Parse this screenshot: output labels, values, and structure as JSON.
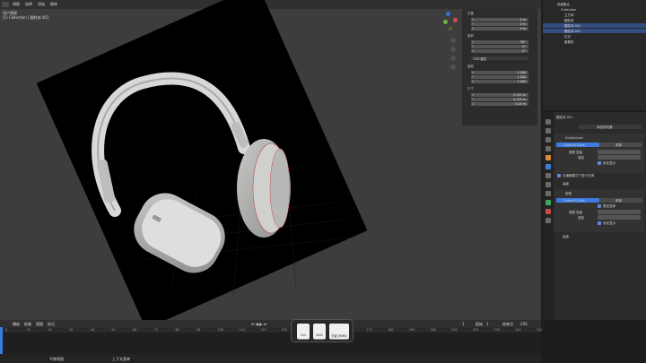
{
  "viewport": {
    "info_lines": [
      "用户透视",
      "(1) Collection | 圆柱体.001"
    ],
    "header_items": [
      "视图",
      "选择",
      "添加",
      "物体"
    ]
  },
  "n_panel": {
    "location_title": "位置",
    "rotation_title": "旋转",
    "rotation_mode": "XYZ 欧拉",
    "scale_title": "缩放",
    "dimensions_title": "尺寸",
    "location": [
      {
        "axis": "X",
        "value": "0 m"
      },
      {
        "axis": "Y",
        "value": "0 m"
      },
      {
        "axis": "Z",
        "value": "0 m"
      }
    ],
    "rotation": [
      {
        "axis": "X",
        "value": "90°"
      },
      {
        "axis": "Y",
        "value": "0°"
      },
      {
        "axis": "Z",
        "value": "0°"
      }
    ],
    "scale": [
      {
        "axis": "X",
        "value": "1.000"
      },
      {
        "axis": "Y",
        "value": "1.000"
      },
      {
        "axis": "Z",
        "value": "1.000"
      }
    ],
    "dimensions": [
      {
        "axis": "X",
        "value": "0.193 m"
      },
      {
        "axis": "Y",
        "value": "0.193 m"
      },
      {
        "axis": "Z",
        "value": "0.04 m"
      }
    ]
  },
  "outliner": {
    "rows": [
      {
        "label": "场景集合",
        "indent": 0,
        "selected": false
      },
      {
        "label": "Collection",
        "indent": 4,
        "selected": false
      },
      {
        "label": "立方体",
        "indent": 8,
        "selected": false
      },
      {
        "label": "圆柱体",
        "indent": 8,
        "selected": false
      },
      {
        "label": "圆柱体.001",
        "indent": 8,
        "selected": true
      },
      {
        "label": "圆柱体.002",
        "indent": 8,
        "selected": true
      },
      {
        "label": "灯光",
        "indent": 8,
        "selected": false
      },
      {
        "label": "摄像机",
        "indent": 8,
        "selected": false
      }
    ]
  },
  "properties": {
    "context": "圆柱体.001",
    "modifier_add": "添加修改器",
    "modifier1": {
      "name": "Subdivision",
      "tab_a": "Catmull-Clark",
      "tab_b": "简单",
      "field1": "视图 层级",
      "field2": "渲染",
      "check": "优化显示"
    },
    "extra": "在编辑模式下进行光滑",
    "sub_label": "高级",
    "modifier2": {
      "name": "倒角",
      "tab_a": "Catmull-Clark",
      "tab_b": "简单",
      "check0": "限定选择",
      "field1": "视图 层级",
      "field2": "渲染",
      "check": "优化显示"
    },
    "footer": "高级"
  },
  "timeline": {
    "menus": [
      "播放",
      "抠像",
      "视图",
      "标记"
    ],
    "frame_current": "1",
    "start_label": "起始",
    "start_value": "1",
    "end_label": "结束点",
    "end_value": "250",
    "ticks": [
      "0",
      "10",
      "20",
      "30",
      "40",
      "50",
      "60",
      "70",
      "80",
      "90",
      "100",
      "110",
      "120",
      "130",
      "140",
      "150",
      "160",
      "170",
      "180",
      "190",
      "200",
      "210",
      "220",
      "230",
      "240",
      "250"
    ],
    "status_left": "平移视图",
    "status_mid": "上下文菜单"
  },
  "keys": [
    {
      "label": "Ctrl"
    },
    {
      "label": "Shift"
    },
    {
      "label": "右键 (RMB)"
    }
  ],
  "colors": {
    "accent": "#3d7be0",
    "selected_row": "#334d80",
    "header": "#303030"
  }
}
